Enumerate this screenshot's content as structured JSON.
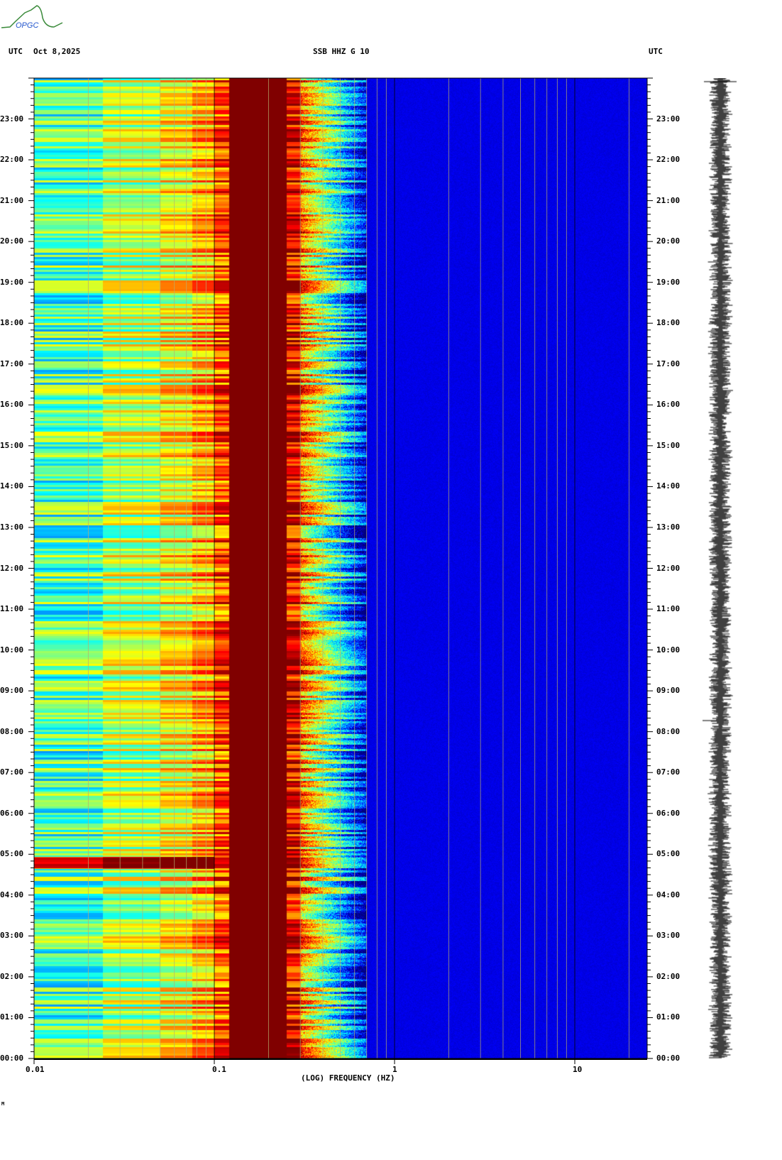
{
  "logo_text": "OPGC",
  "header": {
    "left_tz": "UTC",
    "date": "Oct 8,2025",
    "title": "SSB HHZ G 10",
    "right_tz": "UTC"
  },
  "footer_mark": "M",
  "chart_data": {
    "type": "heatmap",
    "title": "SSB HHZ G 10",
    "xlabel": "(LOG) FREQUENCY (HZ)",
    "xscale": "log",
    "xlim": [
      0.01,
      25
    ],
    "xticks": [
      0.01,
      0.1,
      1,
      10
    ],
    "xtick_labels": [
      "0.01",
      "0.1",
      "1",
      "10"
    ],
    "ylim_hours": [
      0,
      24
    ],
    "ytick_labels": [
      "00:00",
      "01:00",
      "02:00",
      "03:00",
      "04:00",
      "05:00",
      "06:00",
      "07:00",
      "08:00",
      "09:00",
      "10:00",
      "11:00",
      "12:00",
      "13:00",
      "14:00",
      "15:00",
      "16:00",
      "17:00",
      "18:00",
      "19:00",
      "20:00",
      "21:00",
      "22:00",
      "23:00"
    ],
    "colormap": "jet",
    "bands": [
      {
        "fmin": 0.01,
        "fmax": 0.024,
        "level": 0.45
      },
      {
        "fmin": 0.024,
        "fmax": 0.05,
        "level": 0.55
      },
      {
        "fmin": 0.05,
        "fmax": 0.075,
        "level": 0.62
      },
      {
        "fmin": 0.075,
        "fmax": 0.1,
        "level": 0.7
      },
      {
        "fmin": 0.1,
        "fmax": 0.12,
        "level": 0.8
      },
      {
        "fmin": 0.12,
        "fmax": 0.25,
        "level": 1.0
      },
      {
        "fmin": 0.25,
        "fmax": 0.3,
        "level": 0.88
      },
      {
        "fmin": 0.3,
        "fmax": 0.45,
        "level": 0.55
      },
      {
        "fmin": 0.45,
        "fmax": 0.7,
        "level": 0.2
      },
      {
        "fmin": 0.7,
        "fmax": 25,
        "level": 0.1
      }
    ],
    "events": [
      {
        "time_hours": 4.8,
        "level_boost": 0.35
      }
    ]
  }
}
